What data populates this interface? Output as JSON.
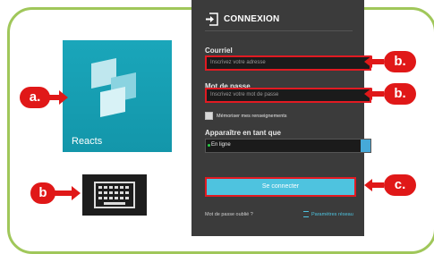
{
  "app": {
    "label": "Reacts"
  },
  "callouts": {
    "a": "a.",
    "b1": "b.",
    "b2": "b.",
    "b3": "b",
    "c": "c."
  },
  "login": {
    "title": "CONNEXION",
    "email_label": "Courriel",
    "email_placeholder": "Inscrivez votre adresse",
    "password_label": "Mot de passe",
    "password_placeholder": "Inscrivez votre mot de passe",
    "remember": "Mémoriser mes renseignements",
    "appear_label": "Apparaître en tant que",
    "status_value": "En ligne",
    "submit": "Se connecter",
    "forgot": "Mot de passe oublié ?",
    "network": "Paramètres réseau"
  },
  "colors": {
    "accent": "#e01818",
    "brand": "#1aa6ba",
    "frame": "#a0c75a",
    "button": "#4ec3df"
  }
}
